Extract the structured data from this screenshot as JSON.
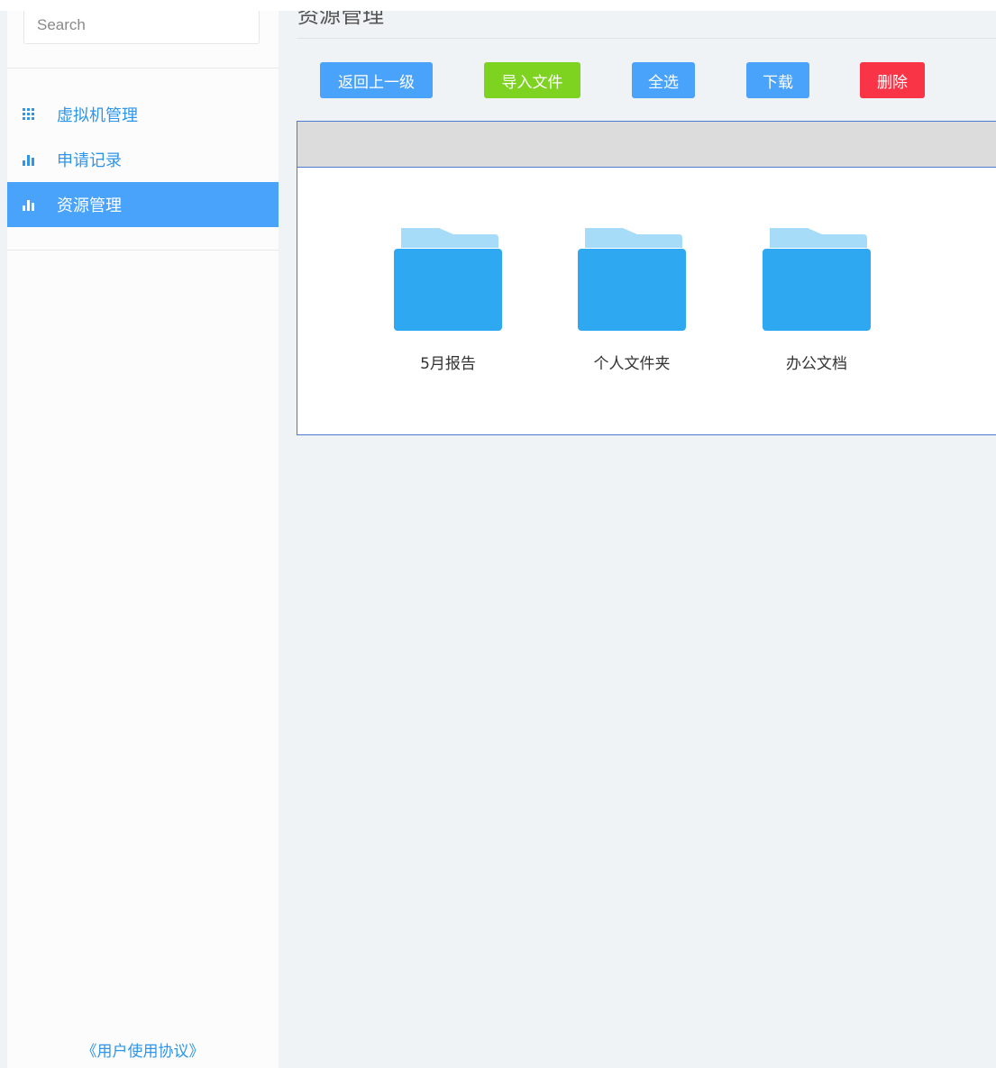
{
  "sidebar": {
    "search": {
      "placeholder": "Search",
      "value": ""
    },
    "items": [
      {
        "label": "虚拟机管理",
        "icon": "grid-icon",
        "active": false
      },
      {
        "label": "申请记录",
        "icon": "bar-chart-icon",
        "active": false
      },
      {
        "label": "资源管理",
        "icon": "bar-chart-icon",
        "active": true
      }
    ],
    "footer_link": "《用户使用协议》"
  },
  "main": {
    "title": "资源管理",
    "toolbar": {
      "back_label": "返回上一级",
      "import_label": "导入文件",
      "select_all_label": "全选",
      "download_label": "下载",
      "delete_label": "删除"
    },
    "folders": [
      {
        "name": "5月报告",
        "icon": "folder-icon"
      },
      {
        "name": "个人文件夹",
        "icon": "folder-icon"
      },
      {
        "name": "办公文档",
        "icon": "folder-icon"
      }
    ]
  },
  "colors": {
    "primary_blue": "#4aa3fb",
    "import_green": "#7ed321",
    "delete_red": "#f83446",
    "link_blue": "#2e95e8",
    "folder_blue": "#2fa8f2",
    "folder_tab_light": "#a7dcf8",
    "panel_border": "#4a7bd0"
  }
}
